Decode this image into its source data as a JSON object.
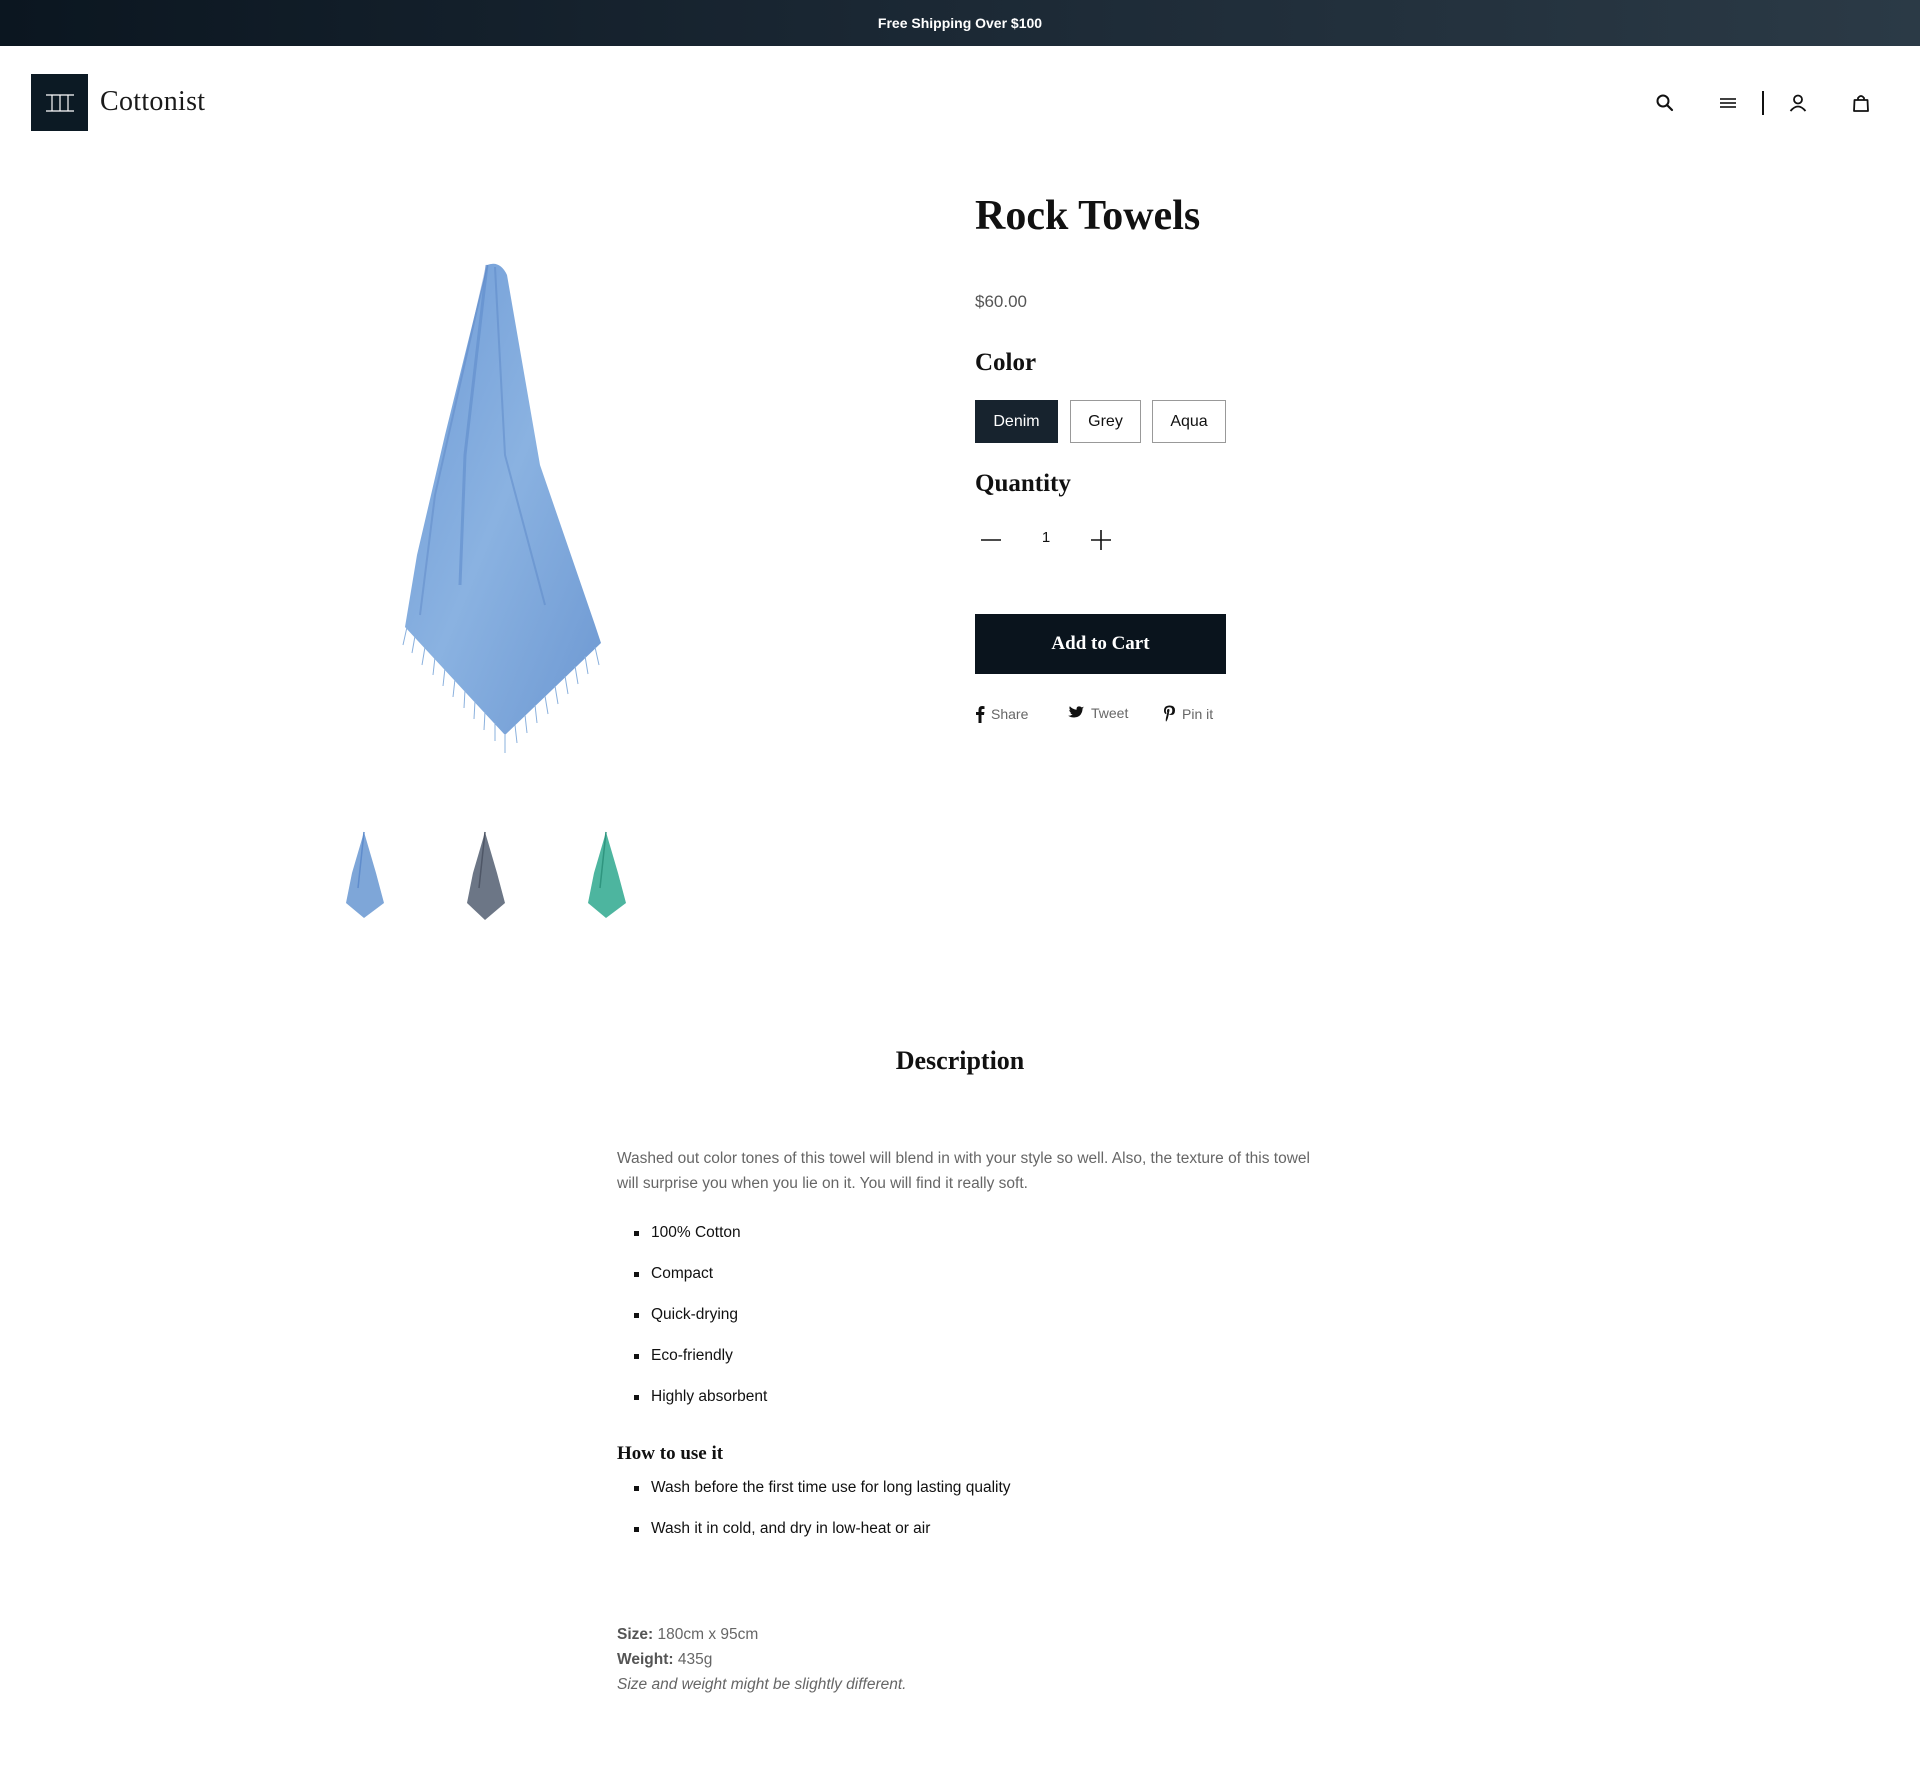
{
  "announcement": "Free Shipping Over $100",
  "brand": {
    "name": "Cottonist",
    "color": "#0c1a24"
  },
  "header_icons": [
    "search-icon",
    "menu-icon",
    "account-icon",
    "cart-icon"
  ],
  "product": {
    "title": "Rock Towels",
    "price": "$60.00",
    "color_label": "Color",
    "colors": [
      "Denim",
      "Grey",
      "Aqua"
    ],
    "selected_color": "Denim",
    "quantity_label": "Quantity",
    "quantity": "1",
    "add_to_cart": "Add to Cart",
    "swatch_colors": {
      "denim": "#7ea6d8",
      "grey": "#6c7686",
      "aqua": "#4db59f"
    }
  },
  "share": {
    "facebook": "Share",
    "twitter": "Tweet",
    "pinterest": "Pin it"
  },
  "description": {
    "heading": "Description",
    "text": "Washed out color tones of this towel will blend in with your style so well. Also, the texture of this towel will surprise you when you lie on it. You will find it really soft.",
    "features": [
      "100% Cotton",
      "Compact",
      "Quick-drying",
      "Eco-friendly",
      "Highly absorbent"
    ],
    "how_to_heading": "How to use it",
    "how_to": [
      "Wash before the first time use for long lasting quality",
      "Wash it in cold, and dry in low-heat or air"
    ],
    "size_label": "Size:",
    "size": "180cm x 95cm",
    "weight_label": "Weight:",
    "weight": "435g",
    "note": "Size and weight might be slightly different."
  }
}
